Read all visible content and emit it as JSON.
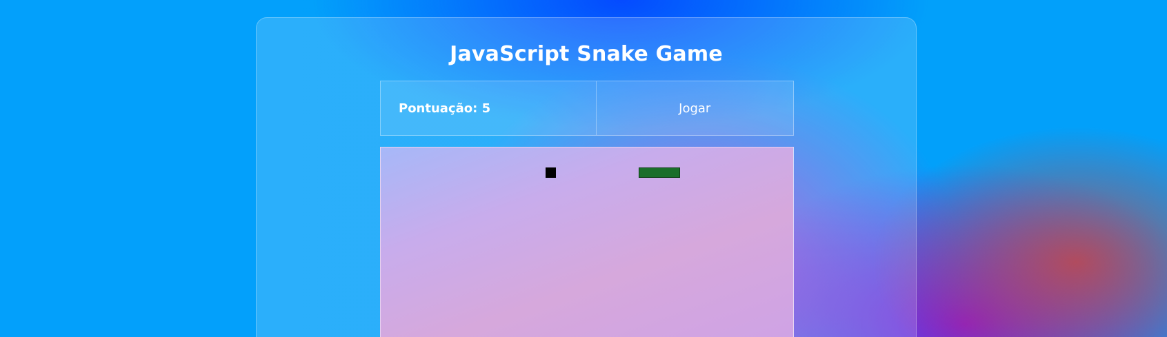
{
  "game": {
    "title": "JavaScript Snake Game",
    "score_text": "Pontuação: 5",
    "score": 5,
    "play_label": "Jogar"
  },
  "colors": {
    "snake": "#1a6e2a",
    "food": "#000000"
  }
}
